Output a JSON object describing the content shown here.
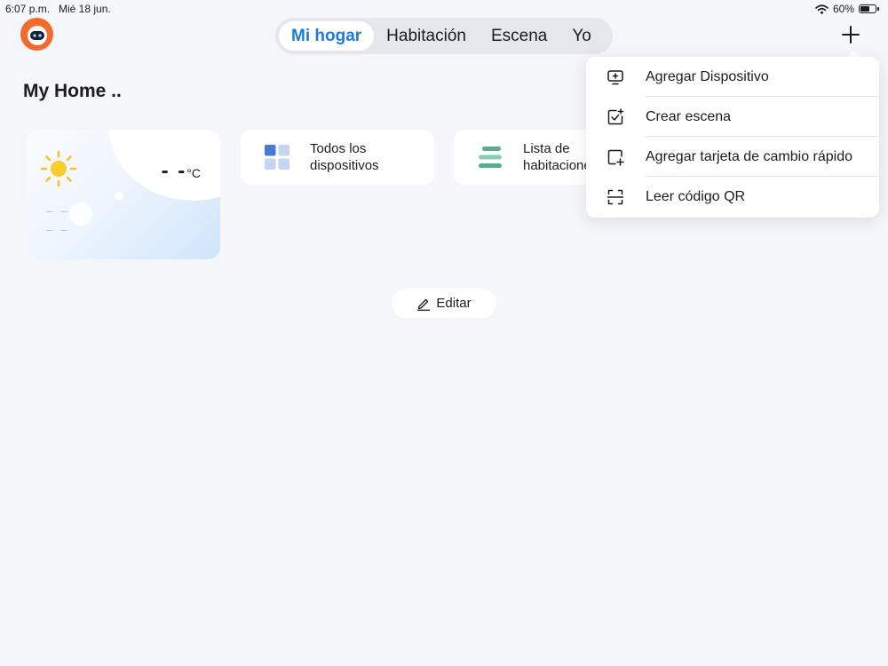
{
  "status_bar": {
    "time": "6:07 p.m.",
    "date": "Mié 18 jun.",
    "battery": "60%"
  },
  "tabs": [
    {
      "label": "Mi hogar",
      "active": true
    },
    {
      "label": "Habitación",
      "active": false
    },
    {
      "label": "Escena",
      "active": false
    },
    {
      "label": "Yo",
      "active": false
    }
  ],
  "home": {
    "title": "My Home .."
  },
  "weather": {
    "temp": "- -",
    "unit": "°C",
    "line1": "– –",
    "line2": "– –"
  },
  "cards": {
    "devices": "Todos los dispositivos",
    "rooms": "Lista de habitaciones"
  },
  "edit": {
    "label": "Editar"
  },
  "dropdown": {
    "items": [
      {
        "label": "Agregar Dispositivo",
        "icon": "add-device-icon"
      },
      {
        "label": "Crear escena",
        "icon": "create-scene-icon"
      },
      {
        "label": "Agregar tarjeta de cambio rápido",
        "icon": "add-card-icon"
      },
      {
        "label": "Leer código QR",
        "icon": "qr-scan-icon"
      }
    ]
  },
  "colors": {
    "accent": "#1f7ae0",
    "brand": "#f26b2d",
    "rooms_icon": "#5aac8f",
    "devices_icon": "#4a7bd0"
  }
}
